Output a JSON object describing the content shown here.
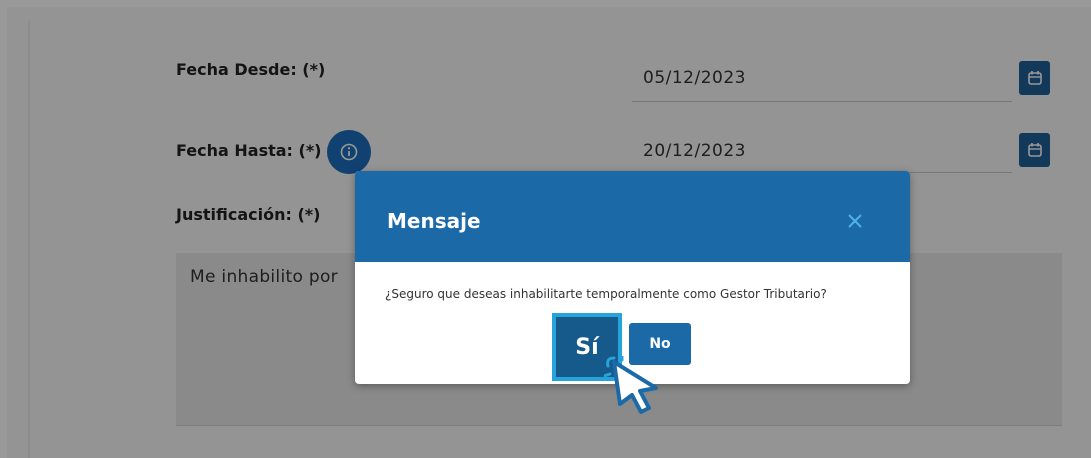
{
  "form": {
    "fecha_desde_label": "Fecha Desde: (*)",
    "fecha_desde_value": "05/12/2023",
    "fecha_hasta_label": "Fecha Hasta: (*)",
    "fecha_hasta_value": "20/12/2023",
    "justificacion_label": "Justificación: (*)",
    "justificacion_value": "Me inhabilito por"
  },
  "modal": {
    "title": "Mensaje",
    "message": "¿Seguro que deseas inhabilitarte temporalmente como Gestor Tributario?",
    "confirm_label": "Sí",
    "cancel_label": "No"
  },
  "colors": {
    "primary": "#1b6aa7",
    "focus_ring": "#27a3db",
    "info": "#1c6dbd"
  },
  "icons": {
    "calendar": "calendar-icon",
    "info": "info-icon",
    "close": "close-icon",
    "cursor": "pointer-cursor-icon"
  }
}
